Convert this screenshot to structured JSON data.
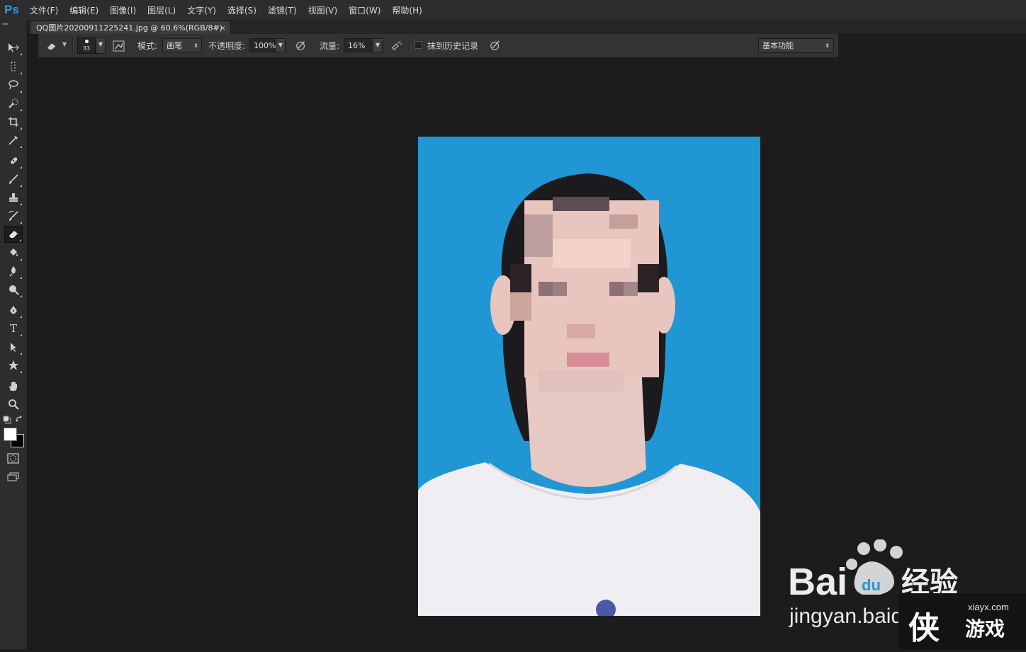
{
  "app": {
    "logo": "Ps",
    "accent": "#2e9ae6"
  },
  "menu": [
    "文件(F)",
    "编辑(E)",
    "图像(I)",
    "图层(L)",
    "文字(Y)",
    "选择(S)",
    "滤镜(T)",
    "视图(V)",
    "窗口(W)",
    "帮助(H)"
  ],
  "document_tab": {
    "title": "QQ图片20200911225241.jpg @ 60.6%(RGB/8#)",
    "close": "×"
  },
  "options": {
    "tool_icon": "eraser-icon",
    "brush_size": "33",
    "mode_label": "模式:",
    "mode_value": "画笔",
    "opacity_label": "不透明度:",
    "opacity_value": "100%",
    "flow_label": "流量:",
    "flow_value": "16%",
    "erase_history_label": "抹到历史记录",
    "erase_history_checked": false,
    "workspace": "基本功能"
  },
  "tools": [
    "move-icon",
    "marquee-icon",
    "lasso-icon",
    "quick-select-icon",
    "crop-icon",
    "eyedropper-icon",
    "healing-brush-icon",
    "brush-icon",
    "clone-stamp-icon",
    "history-brush-icon",
    "eraser-icon",
    "paint-bucket-icon",
    "blur-icon",
    "dodge-icon",
    "pen-icon",
    "type-icon",
    "path-select-icon",
    "shape-icon",
    "hand-icon",
    "zoom-icon"
  ],
  "active_tool": "eraser-icon",
  "colors": {
    "foreground": "#ffffff",
    "background": "#000000",
    "canvas_bg": "#2196d5"
  },
  "watermarks": {
    "baidu_text": "Bai",
    "baidu_du": "du",
    "baidu_jingyan": "经验",
    "baidu_url": "jingyan.baidu.com",
    "xia_site": "xiayx.com",
    "xia_char": "侠",
    "xia_text": "游戏"
  }
}
